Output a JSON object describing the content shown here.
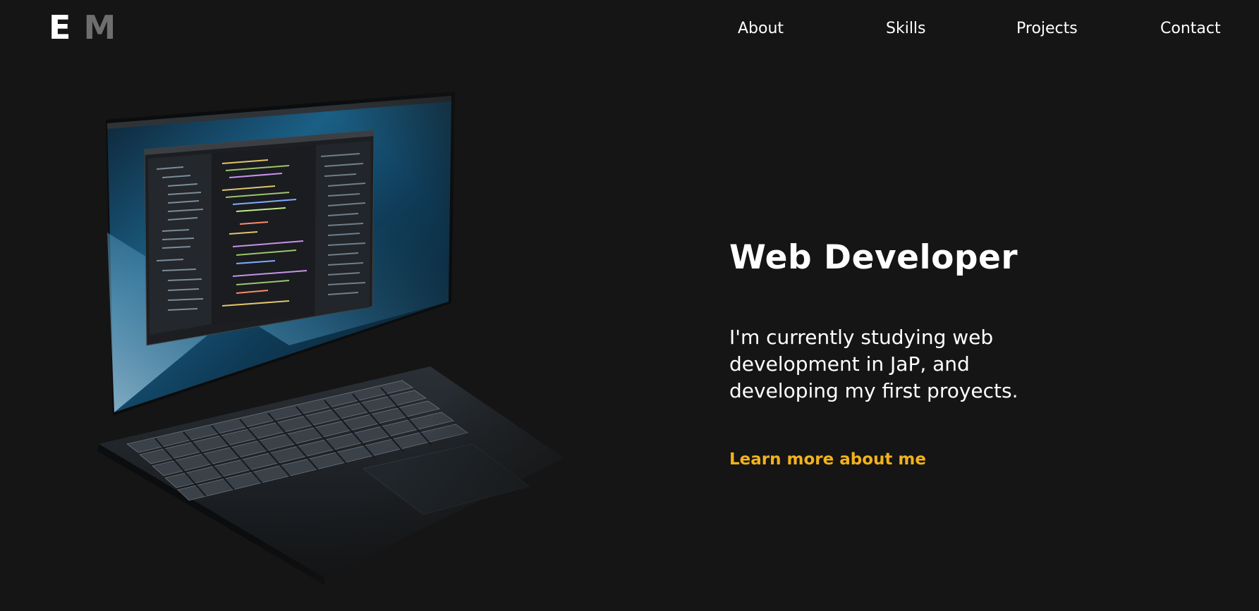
{
  "header": {
    "logo_letter_1": "E",
    "logo_letter_2": "M",
    "nav": [
      "About",
      "Skills",
      "Projects",
      "Contact"
    ]
  },
  "hero": {
    "title": "Web Developer",
    "description": "I'm currently studying web development in JaP, and developing my first proyects.",
    "cta_label": "Learn more about me",
    "image": "laptop-code-editor-photo"
  },
  "colors": {
    "background": "#151515",
    "text": "#ffffff",
    "logo_secondary": "#6e6e6e",
    "accent": "#f2b21b"
  }
}
